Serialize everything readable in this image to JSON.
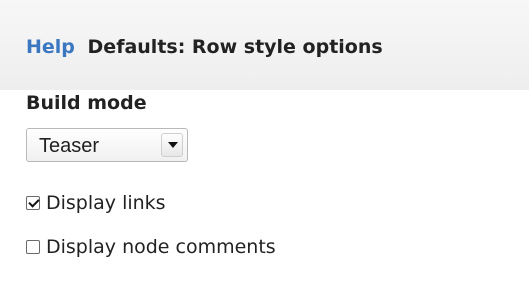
{
  "header": {
    "help_link": "Help",
    "title": "Defaults: Row style options"
  },
  "form": {
    "build_mode_label": "Build mode",
    "build_mode_value": "Teaser",
    "display_links": {
      "label": "Display links",
      "checked": true
    },
    "display_node_comments": {
      "label": "Display node comments",
      "checked": false
    }
  }
}
